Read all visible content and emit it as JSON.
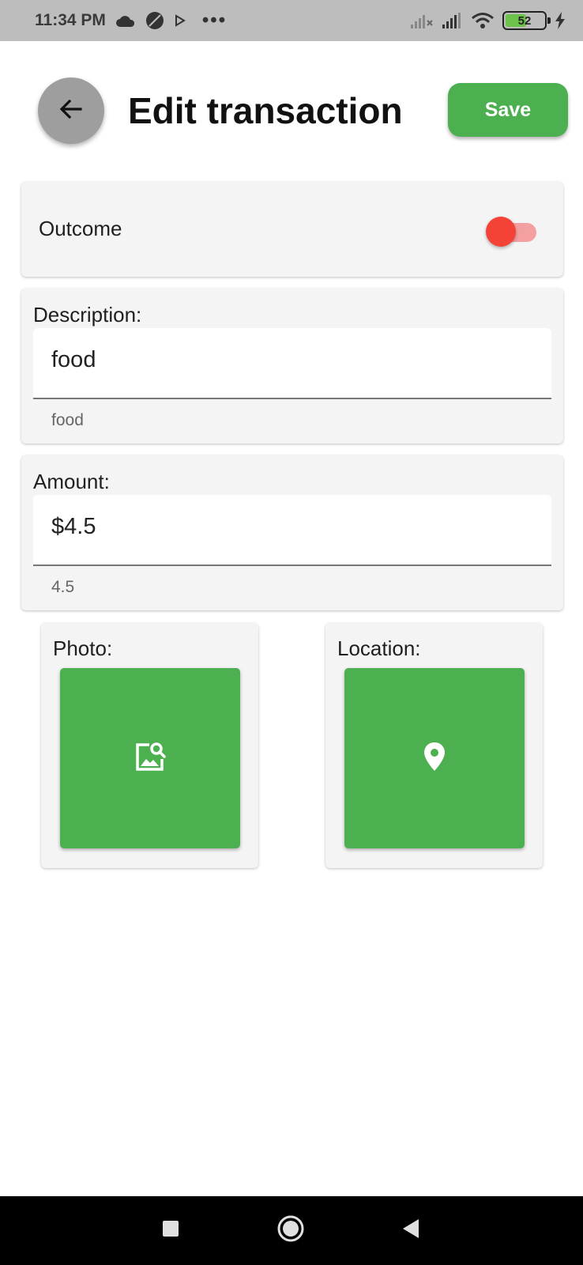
{
  "status_bar": {
    "time": "11:34 PM",
    "battery_level": "52",
    "icons": [
      "cloud-icon",
      "circle-slash-icon",
      "play-icon",
      "more-dots-icon",
      "signal-x-icon",
      "signal-icon",
      "wifi-icon",
      "battery-icon",
      "charging-bolt-icon"
    ]
  },
  "header": {
    "title": "Edit transaction",
    "back_icon": "arrow-left-icon",
    "save_label": "Save"
  },
  "outcome": {
    "label": "Outcome",
    "toggle_on": true
  },
  "description": {
    "label": "Description:",
    "value": "food",
    "helper": "food"
  },
  "amount": {
    "label": "Amount:",
    "value": "$4.5",
    "helper": "4.5"
  },
  "photo": {
    "label": "Photo:",
    "icon": "image-search-icon"
  },
  "location": {
    "label": "Location:",
    "icon": "map-pin-icon"
  },
  "nav_bar": {
    "icons": [
      "recents-square-icon",
      "home-circle-icon",
      "back-triangle-icon"
    ]
  },
  "colors": {
    "accent_green": "#4caf50",
    "toggle_red": "#f44336",
    "card_bg": "#f4f4f4",
    "status_bar_bg": "#bdbdbd"
  }
}
